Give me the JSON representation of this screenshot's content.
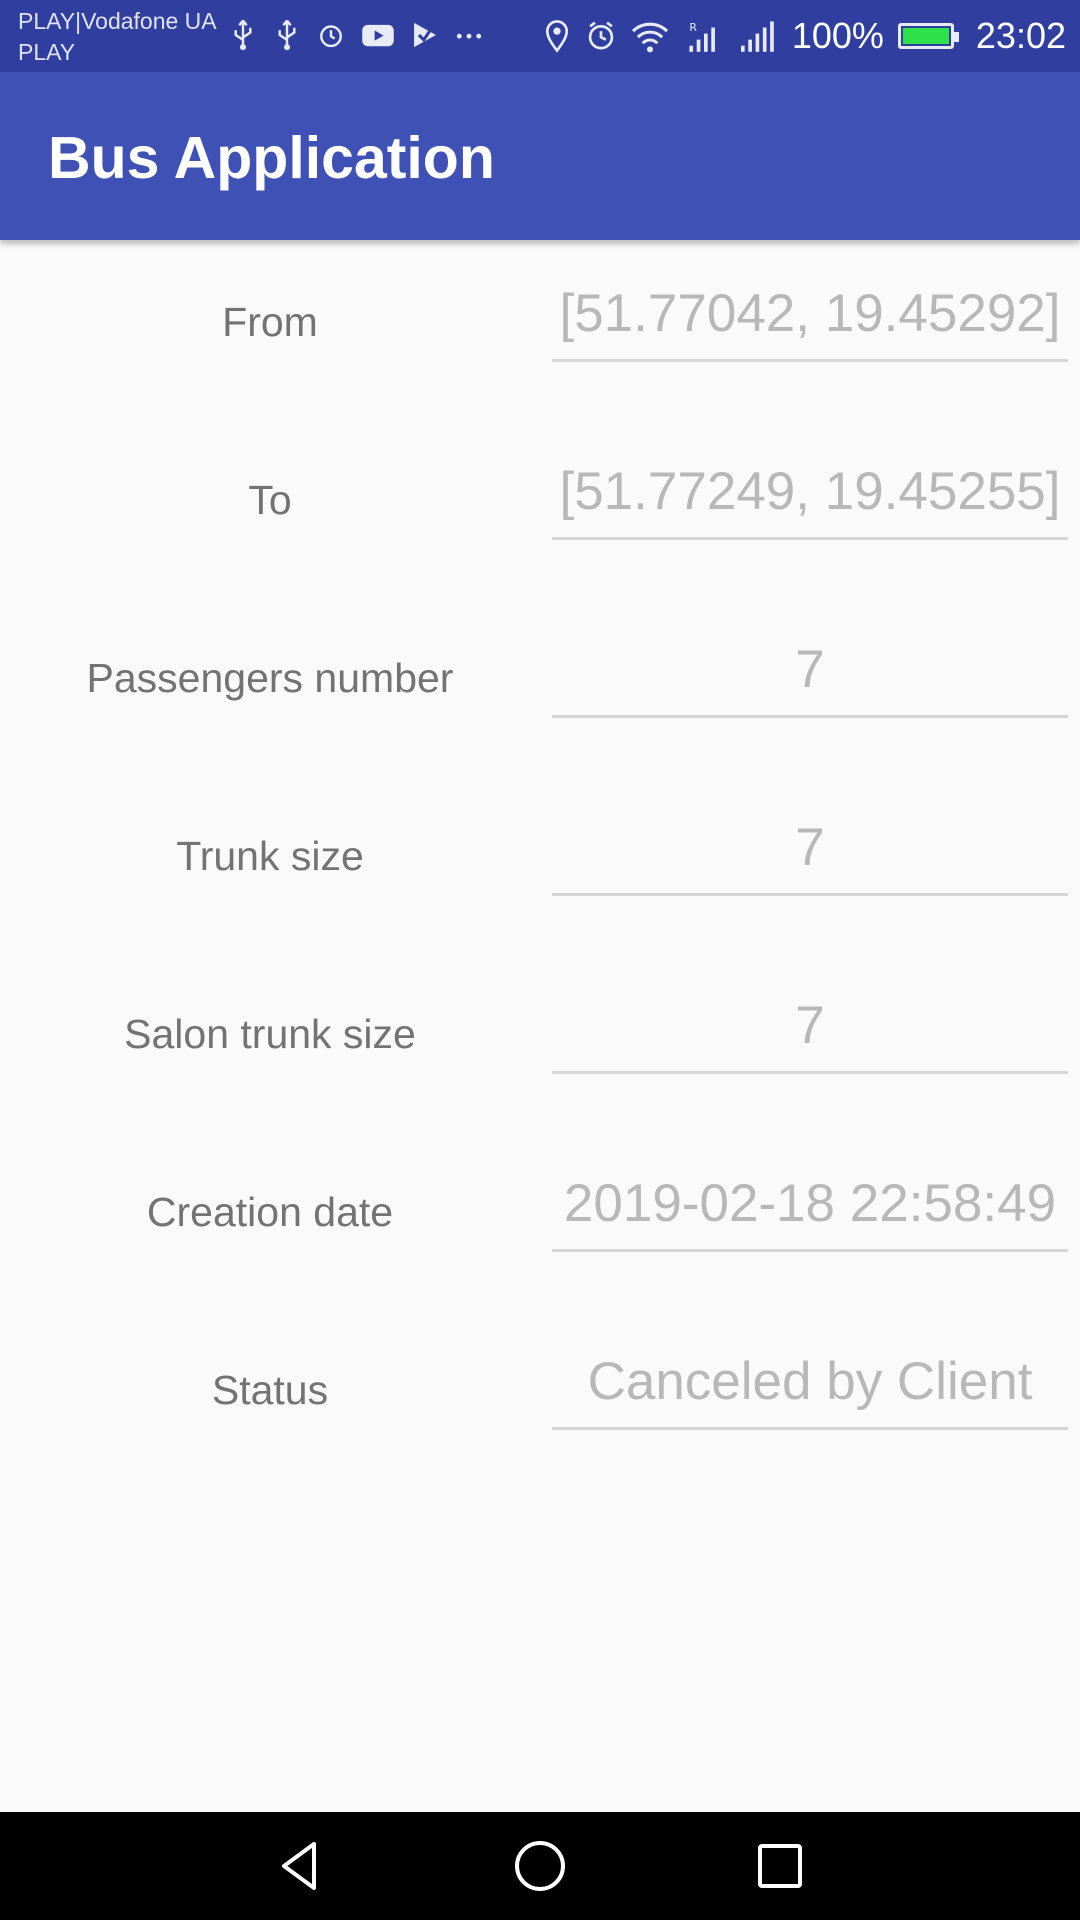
{
  "status_bar": {
    "carrier_line1": "PLAY|Vodafone UA",
    "carrier_line2": "PLAY",
    "battery": "100%",
    "time": "23:02",
    "battery_color": "#2ee04a",
    "icons_left": [
      "usb-icon",
      "usb-icon",
      "alarm-icon",
      "youtube-icon",
      "check-app-icon",
      "more-icon"
    ],
    "icons_right": [
      "location-icon",
      "alarm-icon",
      "wifi-icon",
      "signal-roaming-icon",
      "signal-icon",
      "battery-icon"
    ]
  },
  "app_bar": {
    "title": "Bus Application",
    "color": "#3f51b5"
  },
  "form": {
    "rows": [
      {
        "label": "From",
        "value": "[51.77042, 19.45292]"
      },
      {
        "label": "To",
        "value": "[51.77249, 19.45255]"
      },
      {
        "label": "Passengers number",
        "value": "7"
      },
      {
        "label": "Trunk size",
        "value": "7"
      },
      {
        "label": "Salon trunk size",
        "value": "7"
      },
      {
        "label": "Creation date",
        "value": "2019-02-18 22:58:49"
      },
      {
        "label": "Status",
        "value": "Canceled by Client"
      }
    ]
  },
  "nav_bar": {
    "buttons": [
      "back-icon",
      "home-icon",
      "recents-icon"
    ]
  }
}
